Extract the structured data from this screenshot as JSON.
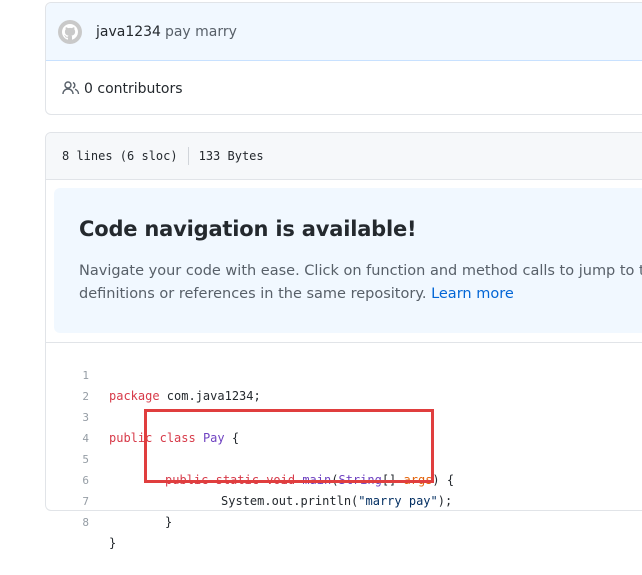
{
  "commit": {
    "author": "java1234",
    "message": "pay marry"
  },
  "contributors": {
    "count": "0",
    "label": "contributors"
  },
  "file": {
    "lines": "8 lines (6 sloc)",
    "size": "133 Bytes"
  },
  "code_navigation": {
    "title": "Code navigation is available!",
    "description": "Navigate your code with ease. Click on function and method calls to jump to their definitions or references in the same repository.",
    "learn_more": "Learn more"
  },
  "code": {
    "line_numbers": [
      "1",
      "2",
      "3",
      "4",
      "5",
      "6",
      "7",
      "8"
    ],
    "l1_kw": "package",
    "l1_rest": " com.java1234;",
    "l3_kw1": "public",
    "l3_kw2": "class",
    "l3_name": "Pay",
    "l3_rest": " {",
    "l5_kw1": "public",
    "l5_kw2": "static",
    "l5_kw3": "void",
    "l5_fn": "main",
    "l5_p1": "(",
    "l5_type": "String",
    "l5_p2": "[] ",
    "l5_arg": "args",
    "l5_p3": ") {",
    "l6_pre": "System.out.println(",
    "l6_str": "\"marry pay\"",
    "l6_post": ");",
    "l7": "}",
    "l8": "}"
  },
  "colors": {
    "highlight_box": "#e03e3e",
    "link": "#0366d6",
    "keyword": "#d73a49"
  }
}
